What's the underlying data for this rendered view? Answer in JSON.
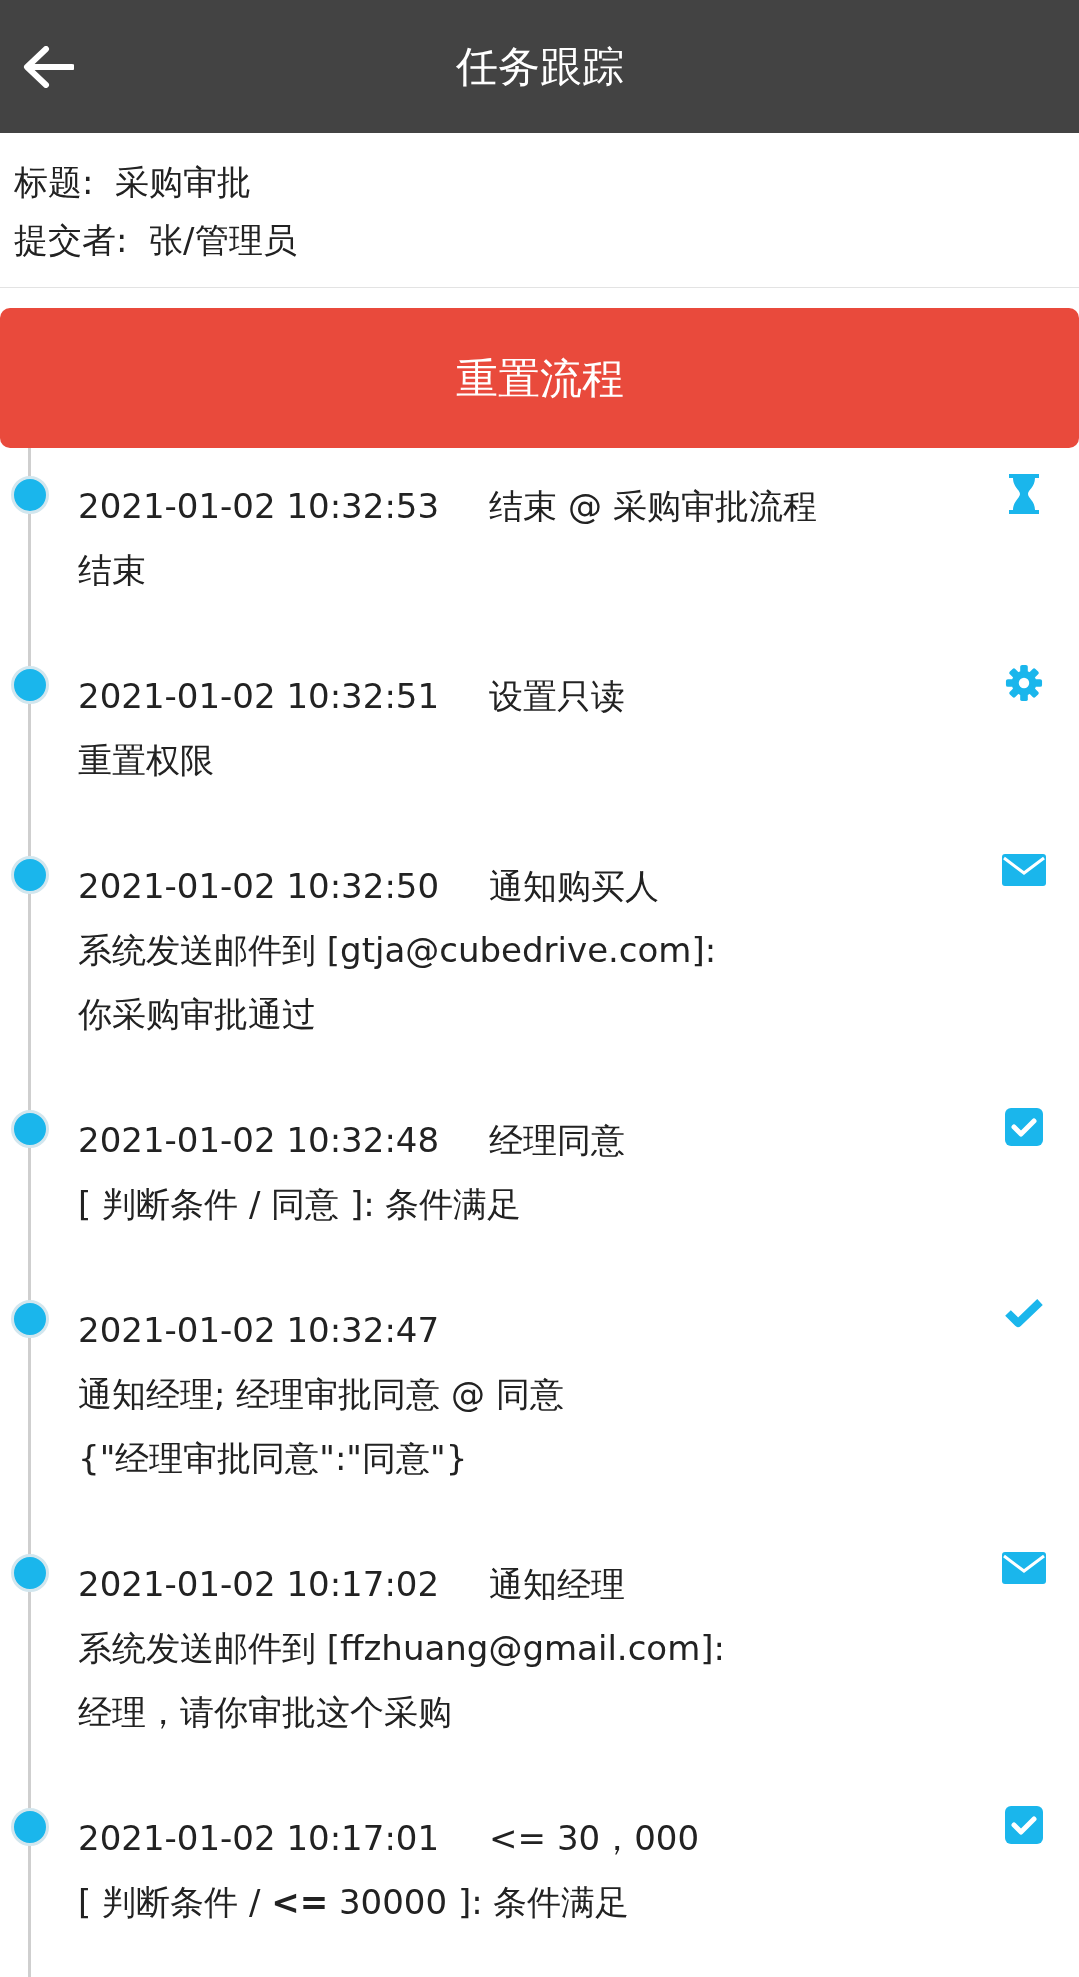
{
  "header": {
    "title": "任务跟踪"
  },
  "info": [
    "标题:  采购审批",
    "提交者:  张/管理员"
  ],
  "reset_button": "重置流程",
  "timeline": [
    {
      "time": "2021-01-02 10:32:53",
      "title": "结束 @ 采购审批流程",
      "details": [
        "结束"
      ],
      "kind": "hourglass"
    },
    {
      "time": "2021-01-02 10:32:51",
      "title": "设置只读",
      "details": [
        "重置权限"
      ],
      "kind": "gear"
    },
    {
      "time": "2021-01-02 10:32:50",
      "title": "通知购买人",
      "details": [
        "系统发送邮件到 [gtja@cubedrive.com]:",
        "你采购审批通过"
      ],
      "kind": "envelope"
    },
    {
      "time": "2021-01-02 10:32:48",
      "title": "经理同意",
      "details": [
        "[ 判断条件 / 同意 ]: 条件满足"
      ],
      "kind": "checkbox"
    },
    {
      "time": "2021-01-02 10:32:47",
      "details": [
        "通知经理; 经理审批同意 @ 同意",
        "{\"经理审批同意\":\"同意\"}"
      ],
      "kind": "check"
    },
    {
      "time": "2021-01-02 10:17:02",
      "title": "通知经理",
      "details": [
        "系统发送邮件到 [ffzhuang@gmail.com]:",
        "经理，请你审批这个采购"
      ],
      "kind": "envelope"
    },
    {
      "time": "2021-01-02 10:17:01",
      "title": "<= 30，000",
      "details": [
        "[ 判断条件 / **<=** 30000 ]: 条件满足"
      ],
      "kind": "checkbox"
    }
  ]
}
